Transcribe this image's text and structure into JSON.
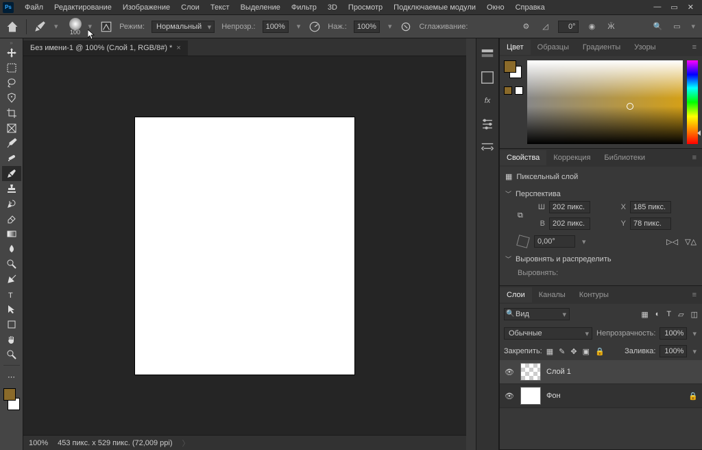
{
  "menubar": [
    "Файл",
    "Редактирование",
    "Изображение",
    "Слои",
    "Текст",
    "Выделение",
    "Фильтр",
    "3D",
    "Просмотр",
    "Подключаемые модули",
    "Окно",
    "Справка"
  ],
  "optionbar": {
    "brush_size": "100",
    "mode_label": "Режим:",
    "mode_value": "Нормальный",
    "opacity_label": "Непрозр.:",
    "opacity_value": "100%",
    "flow_label": "Наж.:",
    "flow_value": "100%",
    "smoothing_label": "Сглаживание:",
    "angle_value": "0°"
  },
  "tab_title": "Без имени-1 @ 100% (Слой 1, RGB/8#) *",
  "statusbar": {
    "zoom": "100%",
    "dims": "453 пикс. x 529 пикс. (72,009 ppi)"
  },
  "colors": {
    "fg": "#8a6a2a",
    "bg": "#ffffff"
  },
  "panel_color": {
    "tabs": [
      "Цвет",
      "Образцы",
      "Градиенты",
      "Узоры"
    ]
  },
  "panel_props": {
    "tabs": [
      "Свойства",
      "Коррекция",
      "Библиотеки"
    ],
    "kind": "Пиксельный слой",
    "perspective": "Перспектива",
    "w_label": "Ш",
    "w_value": "202 пикс.",
    "h_label": "В",
    "h_value": "202 пикс.",
    "x_label": "X",
    "x_value": "185 пикс.",
    "y_label": "Y",
    "y_value": "78 пикс.",
    "angle": "0,00°",
    "align": "Выровнять и распределить",
    "align_sub": "Выровнять:"
  },
  "panel_layers": {
    "tabs": [
      "Слои",
      "Каналы",
      "Контуры"
    ],
    "kind": "Вид",
    "blend": "Обычные",
    "opacity_label": "Непрозрачность:",
    "opacity": "100%",
    "lock_label": "Закрепить:",
    "fill_label": "Заливка:",
    "fill": "100%",
    "layers": [
      {
        "name": "Слой 1",
        "checker": true,
        "locked": false
      },
      {
        "name": "Фон",
        "checker": false,
        "locked": true
      }
    ]
  }
}
